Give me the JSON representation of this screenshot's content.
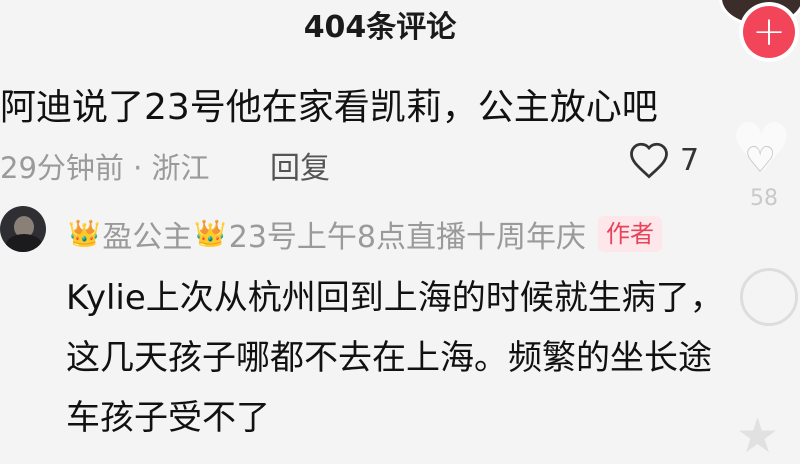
{
  "header": {
    "comment_count_title": "404条评论"
  },
  "comment": {
    "text": "阿迪说了23号他在家看凯莉，公主放心吧",
    "meta": "29分钟前 · 浙江",
    "reply_label": "回复",
    "like_count": "7"
  },
  "reply": {
    "username": "盈公主",
    "status": "23号上午8点直播十周年庆",
    "author_badge": "作者",
    "lines": [
      "Kylie上次从杭州回到上海的时候就生病了，",
      "这几天孩子哪都不去在上海。频繁的坐长途",
      "车孩子受不了"
    ]
  },
  "side": {
    "faint_count": "58"
  },
  "icons": {
    "add": "plus-icon",
    "like": "heart-outline-icon",
    "crown": "crown-icon",
    "star": "star-icon"
  },
  "colors": {
    "accent": "#f2455a",
    "badge_text": "#e9425a",
    "badge_bg": "#fde7ea",
    "meta_gray": "#9a9a9a",
    "crown": "#e8b21c"
  }
}
